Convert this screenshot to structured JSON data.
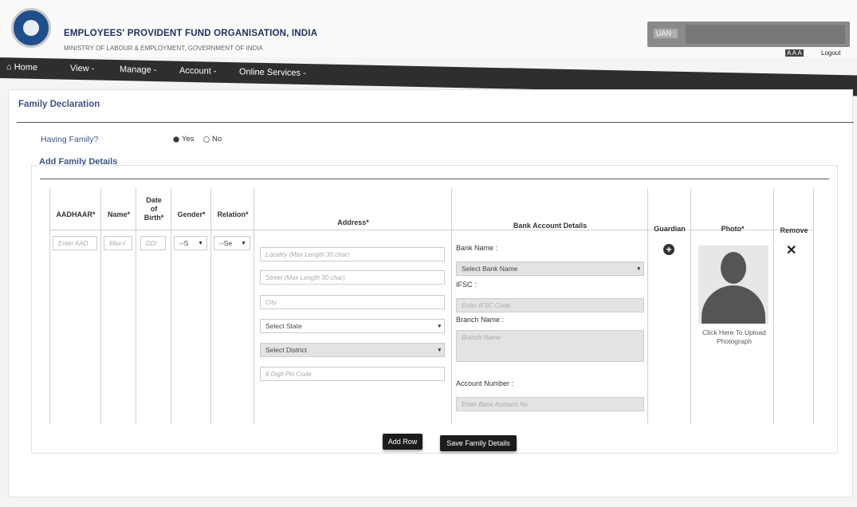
{
  "header": {
    "org_title": "EMPLOYEES' PROVIDENT FUND ORGANISATION, INDIA",
    "org_subtitle": "MINISTRY OF LABOUR & EMPLOYMENT, GOVERNMENT OF INDIA",
    "uan_label": "UAN :",
    "text_size": "A A A",
    "logout": "Logout"
  },
  "nav": [
    "Home",
    "View -",
    "Manage -",
    "Account -",
    "Online Services -"
  ],
  "page_title": "Family Declaration",
  "having_family": {
    "label": "Having Family?",
    "yes": "Yes",
    "no": "No",
    "selected": "Yes"
  },
  "add_family_title": "Add Family Details",
  "table_headers": {
    "aadhaar": "AADHAAR*",
    "name": "Name*",
    "dob": "Date of Birth*",
    "gender": "Gender*",
    "relation": "Relation*",
    "address": "Address*",
    "bank": "Bank Account Details",
    "guardian": "Guardian",
    "photo": "Photo*",
    "remove": "Remove"
  },
  "row": {
    "aadhaar_placeholder": "Enter AAD",
    "name_placeholder": "Max-l",
    "dob_placeholder": "DD/",
    "gender_value": "--S",
    "relation_value": "--Se",
    "locality_placeholder": "Locality (Max Length 30 char)",
    "street_placeholder": "Street (Max Length 30 char)",
    "city_placeholder": "City",
    "state_value": "Select State",
    "district_value": "Select District",
    "pin_placeholder": "6 Digit Pin Code",
    "bank_name_label": "Bank Name :",
    "bank_name_value": "Select Bank Name",
    "ifsc_label": "IFSC :",
    "ifsc_placeholder": "Enter IFSC Code",
    "branch_label": "Branch Name :",
    "branch_placeholder": "Branch Name",
    "account_label": "Account Number :",
    "account_placeholder": "Enter Bank Account No",
    "upload_text": "Click Here To Upload Photograph"
  },
  "buttons": {
    "add_row": "Add Row",
    "save": "Save Family Details"
  }
}
